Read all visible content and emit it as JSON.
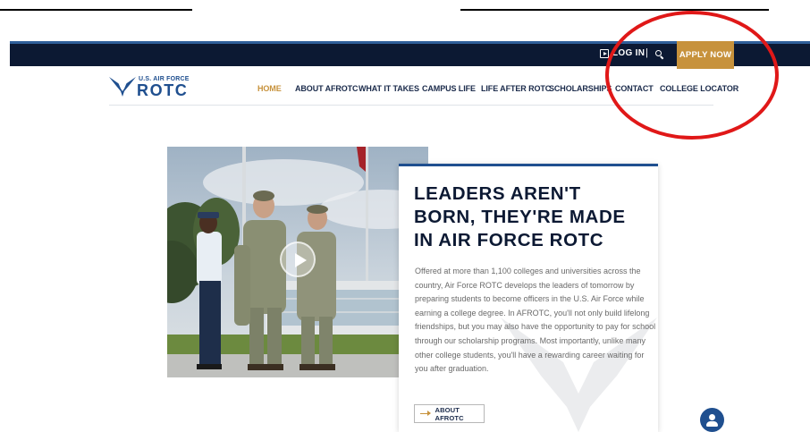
{
  "utility": {
    "login_label": "LOG IN",
    "separator": "|",
    "apply_label": "APPLY NOW"
  },
  "logo": {
    "small_text": "U.S. AIR FORCE",
    "big_text": "ROTC"
  },
  "nav": {
    "items": [
      {
        "label": "HOME",
        "active": true
      },
      {
        "label": "ABOUT AFROTC"
      },
      {
        "label": "WHAT IT TAKES"
      },
      {
        "label": "CAMPUS LIFE"
      },
      {
        "label": "LIFE AFTER ROTC"
      },
      {
        "label": "SCHOLARSHIPS"
      },
      {
        "label": "CONTACT"
      },
      {
        "label": "COLLEGE LOCATOR"
      }
    ]
  },
  "hero": {
    "title_line1": "LEADERS AREN'T",
    "title_line2": "BORN, THEY'RE MADE",
    "title_line3": "IN AIR FORCE ROTC",
    "body": "Offered at more than 1,100 colleges and universities across the country, Air Force ROTC develops the leaders of tomorrow by preparing students to become officers in the U.S. Air Force while earning a college degree. In AFROTC, you'll not only build lifelong friendships, but you may also have the opportunity to pay for school through our scholarship programs. Most importantly, unlike many other college students, you'll have a rewarding career waiting for you after graduation.",
    "cta_label": "ABOUT AFROTC"
  },
  "colors": {
    "navy": "#0c1933",
    "gold": "#c7923c",
    "brand_blue": "#1f4f8f",
    "annotation_red": "#e01818"
  },
  "icons": {
    "login": "login-icon",
    "search": "search-icon",
    "play": "play-icon",
    "chat": "chat-user-icon",
    "arrow": "arrow-right-icon"
  }
}
